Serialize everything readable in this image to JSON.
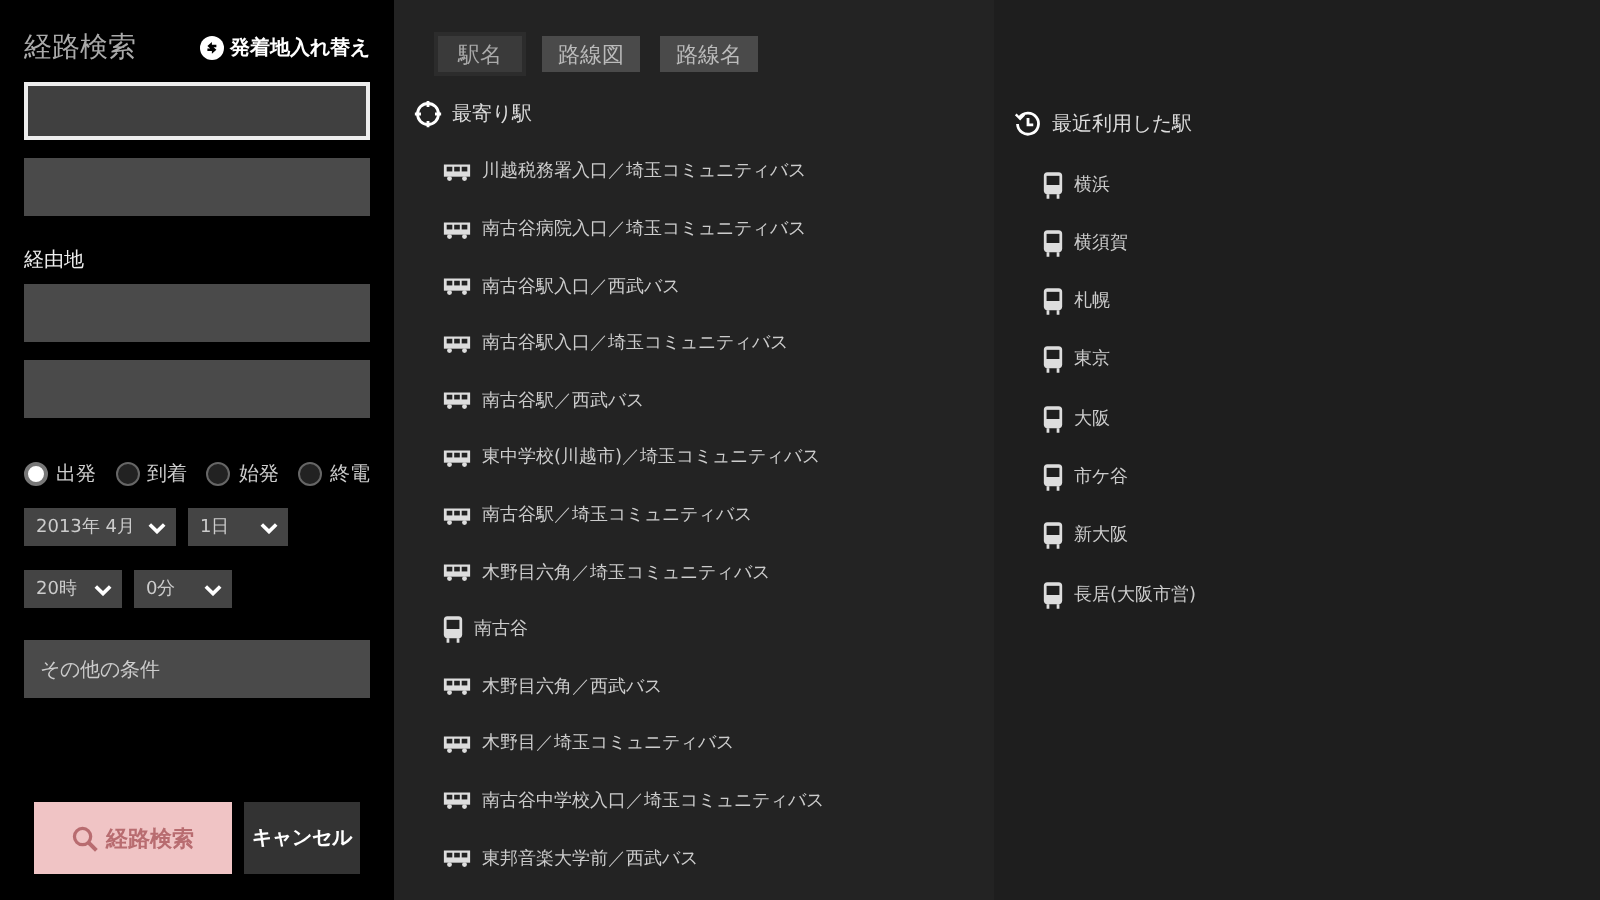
{
  "search_panel": {
    "title": "経路検索",
    "swap_button": "発着地入れ替え",
    "endpoint_fields": [
      {
        "focused": true
      },
      {
        "focused": false
      }
    ],
    "via_label": "経由地",
    "via_fields": [
      {
        "focused": false
      },
      {
        "focused": false
      }
    ],
    "time_modes": [
      {
        "label": "出発",
        "selected": true
      },
      {
        "label": "到着",
        "selected": false
      },
      {
        "label": "始発",
        "selected": false
      },
      {
        "label": "終電",
        "selected": false
      }
    ],
    "date_selects": [
      {
        "value": "2013年 4月"
      },
      {
        "value": "1日"
      }
    ],
    "time_selects": [
      {
        "value": "20時"
      },
      {
        "value": "0分"
      }
    ],
    "other_conditions": "その他の条件",
    "search_button": {
      "label": "経路検索",
      "disabled": true
    },
    "cancel_button": "キャンセル"
  },
  "tabs": [
    {
      "label": "駅名",
      "selected": true
    },
    {
      "label": "路線図",
      "selected": false
    },
    {
      "label": "路線名",
      "selected": false
    }
  ],
  "nearest_stations": {
    "heading": "最寄り駅",
    "items": [
      {
        "kind": "bus",
        "name": "川越税務署入口／埼玉コミュニティバス"
      },
      {
        "kind": "bus",
        "name": "南古谷病院入口／埼玉コミュニティバス"
      },
      {
        "kind": "bus",
        "name": "南古谷駅入口／西武バス"
      },
      {
        "kind": "bus",
        "name": "南古谷駅入口／埼玉コミュニティバス"
      },
      {
        "kind": "bus",
        "name": "南古谷駅／西武バス"
      },
      {
        "kind": "bus",
        "name": "東中学校(川越市)／埼玉コミュニティバス"
      },
      {
        "kind": "bus",
        "name": "南古谷駅／埼玉コミュニティバス"
      },
      {
        "kind": "bus",
        "name": "木野目六角／埼玉コミュニティバス"
      },
      {
        "kind": "train",
        "name": "南古谷"
      },
      {
        "kind": "bus",
        "name": "木野目六角／西武バス"
      },
      {
        "kind": "bus",
        "name": "木野目／埼玉コミュニティバス"
      },
      {
        "kind": "bus",
        "name": "南古谷中学校入口／埼玉コミュニティバス"
      },
      {
        "kind": "bus",
        "name": "東邦音楽大学前／西武バス"
      }
    ]
  },
  "recent_stations": {
    "heading": "最近利用した駅",
    "items": [
      {
        "kind": "train",
        "name": "横浜"
      },
      {
        "kind": "train",
        "name": "横須賀"
      },
      {
        "kind": "train",
        "name": "札幌"
      },
      {
        "kind": "train",
        "name": "東京"
      },
      {
        "kind": "train",
        "name": "大阪"
      },
      {
        "kind": "train",
        "name": "市ケ谷"
      },
      {
        "kind": "train",
        "name": "新大阪"
      },
      {
        "kind": "train",
        "name": "長居(大阪市営)"
      }
    ]
  }
}
